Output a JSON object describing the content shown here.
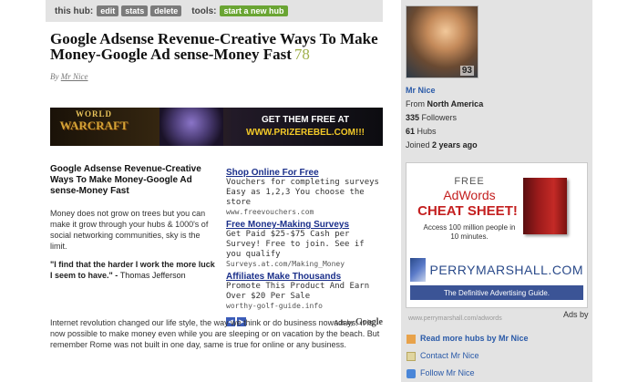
{
  "hub_bar": {
    "label": "this hub:",
    "buttons": [
      "edit",
      "stats",
      "delete"
    ],
    "tools_label": "tools:",
    "start_hub": "start a new hub"
  },
  "article": {
    "title": "Google Adsense Revenue-Creative Ways To Make Money-Google Ad sense-Money Fast",
    "score": "78",
    "byline_prefix": "By",
    "author": "Mr Nice",
    "subtitle": "Google Adsense Revenue-Creative Ways To Make Money-Google Ad sense-Money Fast",
    "para1": "Money does not grow on trees but you can make it grow through your hubs & 1000's of social networking communities, sky is the limit.",
    "quote": "\"I find that the harder I work the more luck I seem to have.\" -",
    "quote_author": "Thomas Jefferson",
    "para2": "Internet revolution changed our life style, the way we think or do business nowadays. It is now possible to make money even while you are sleeping or on vacation by the beach. But remember Rome was not built in one day, same is true for online or any business."
  },
  "banner": {
    "game_top": "WORLD",
    "game_name": "WARCRAFT",
    "cta_line1": "GET THEM FREE AT",
    "cta_line2": "WWW.PRIZEREBEL.COM!!!"
  },
  "ads": [
    {
      "title": "Shop Online For Free",
      "body": "Vouchers for completing surveys Easy as 1,2,3 You choose the store",
      "url": "www.freevouchers.com"
    },
    {
      "title": "Free Money-Making Surveys",
      "body": "Get Paid $25-$75 Cash per Survey! Free to join. See if you qualify",
      "url": "Surveys.at.com/Making_Money"
    },
    {
      "title": "Affiliates Make Thousands",
      "body": "Promote This Product And Earn Over $20 Per Sale",
      "url": "worthy-golf-guide.info"
    }
  ],
  "ads_footer": {
    "prefix": "Ads by",
    "brand": "Google"
  },
  "sidebar": {
    "avatar_score": "93",
    "author_name": "Mr Nice",
    "from_prefix": "From",
    "location": "North America",
    "followers_count": "335",
    "followers_label": "Followers",
    "hubs_count": "61",
    "hubs_label": "Hubs",
    "joined_prefix": "Joined",
    "joined_value": "2 years ago",
    "ad_free": "FREE",
    "ad_adwords": "AdWords",
    "ad_cheat": "CHEAT SHEET!",
    "ad_access": "Access 100 million people in 10 minutes.",
    "ad_logo": "PERRYMARSHALL.COM",
    "ad_tagline": "The Definitive Advertising Guide.",
    "ad_url": "www.perrymarshall.com/adwords",
    "ads_by": "Ads by",
    "links": [
      {
        "label": "Read more hubs by Mr Nice",
        "icon": "hub-icon",
        "bold": true
      },
      {
        "label": "Contact Mr Nice",
        "icon": "mail-icon",
        "bold": false
      },
      {
        "label": "Follow Mr Nice",
        "icon": "follow-icon",
        "bold": false
      }
    ]
  }
}
